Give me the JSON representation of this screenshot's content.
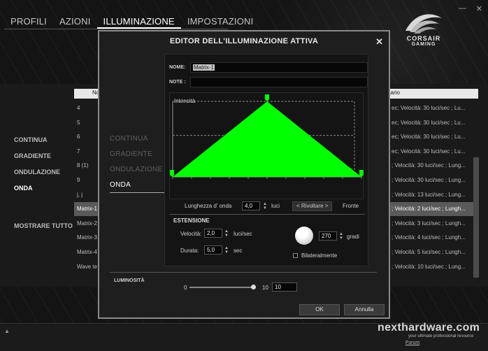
{
  "top_tabs": [
    {
      "label": "PROFILI"
    },
    {
      "label": "AZIONI"
    },
    {
      "label": "ILLUMINAZIONE",
      "active": true
    },
    {
      "label": "IMPOSTAZIONI"
    }
  ],
  "window_controls": {
    "minimize": "—",
    "close": "✕"
  },
  "brand": {
    "line1": "CORSAIR",
    "line2": "GAMING"
  },
  "background": {
    "left_menu": [
      "CONTINUA",
      "GRADIENTE",
      "ONDULAZIONE",
      "ONDA"
    ],
    "show_all": "MOSTRARE TUTTO",
    "table_header": {
      "name": "No",
      "summary": "mario"
    },
    "rows": [
      {
        "name": "4",
        "summary": "ec; Velocità: 30 luci/sec ; Lu..."
      },
      {
        "name": "5",
        "summary": "ec; Velocità: 30 luci/sec ; Lu..."
      },
      {
        "name": "6",
        "summary": "ec; Velocità: 30 luci/sec ; Lu..."
      },
      {
        "name": "7",
        "summary": "ec; Velocità: 30 luci/sec ; Lu..."
      },
      {
        "name": "8 (1)",
        "summary": "; Velocità: 30 luci/sec ; Lung..."
      },
      {
        "name": "9",
        "summary": "; Velocità: 30 luci/sec ; Lung..."
      },
      {
        "name": "j, j",
        "summary": "; Velocità: 13 luci/sec ; Lung..."
      },
      {
        "name": "Matrix-1",
        "summary": "; Velocità: 2 luci/sec ; Lungh...",
        "selected": true
      },
      {
        "name": "Matrix-2",
        "summary": "; Velocità: 3 luci/sec ; Lungh..."
      },
      {
        "name": "Matrix-3",
        "summary": "; Velocità: 4 luci/sec ; Lungh..."
      },
      {
        "name": "Matrix-4",
        "summary": "; Velocità: 5 luci/sec ; Lungh..."
      },
      {
        "name": "Wave te",
        "summary": "; Velocità: 10 luci/sec ; Lung..."
      }
    ]
  },
  "watermark": {
    "main": "nexthardware.com",
    "sub": "your ultimate professional resource",
    "forum": "Forum"
  },
  "modal": {
    "title": "EDITOR DELL'ILLUMINAZIONE ATTIVA",
    "close": "✕",
    "modes": [
      {
        "label": "CONTINUA"
      },
      {
        "label": "GRADIENTE"
      },
      {
        "label": "ONDULAZIONE"
      },
      {
        "label": "ONDA",
        "active": true
      }
    ],
    "name_label": "NOME:",
    "name_value": "Matrix-1",
    "note_label": "NOTE :",
    "note_value": "",
    "chart": {
      "y_label": "Intensità",
      "wave_color": "#00ff00",
      "peak_position": 0.5,
      "dashed_levels": [
        1.0,
        0.55
      ]
    },
    "wave_length": {
      "label": "Lunghezza d' onda",
      "value": "4,0",
      "unit": "luci"
    },
    "reverse_button": "< Rivoltare >",
    "front_label": "Fronte",
    "extension_title": "ESTENSIONE",
    "speed": {
      "label": "Velocità:",
      "value": "2,0",
      "unit": "luci/sec"
    },
    "duration": {
      "label": "Durata:",
      "value": "5,0",
      "unit": "sec"
    },
    "angle": {
      "value": "270",
      "unit": "gradi"
    },
    "bilateral": {
      "label": "Bilateralmente",
      "checked": false
    },
    "brightness": {
      "label": "LUMINOSITÀ",
      "min": "0",
      "max": "10",
      "value": "10",
      "level": 1.0
    },
    "ok": "OK",
    "cancel": "Annulla"
  }
}
